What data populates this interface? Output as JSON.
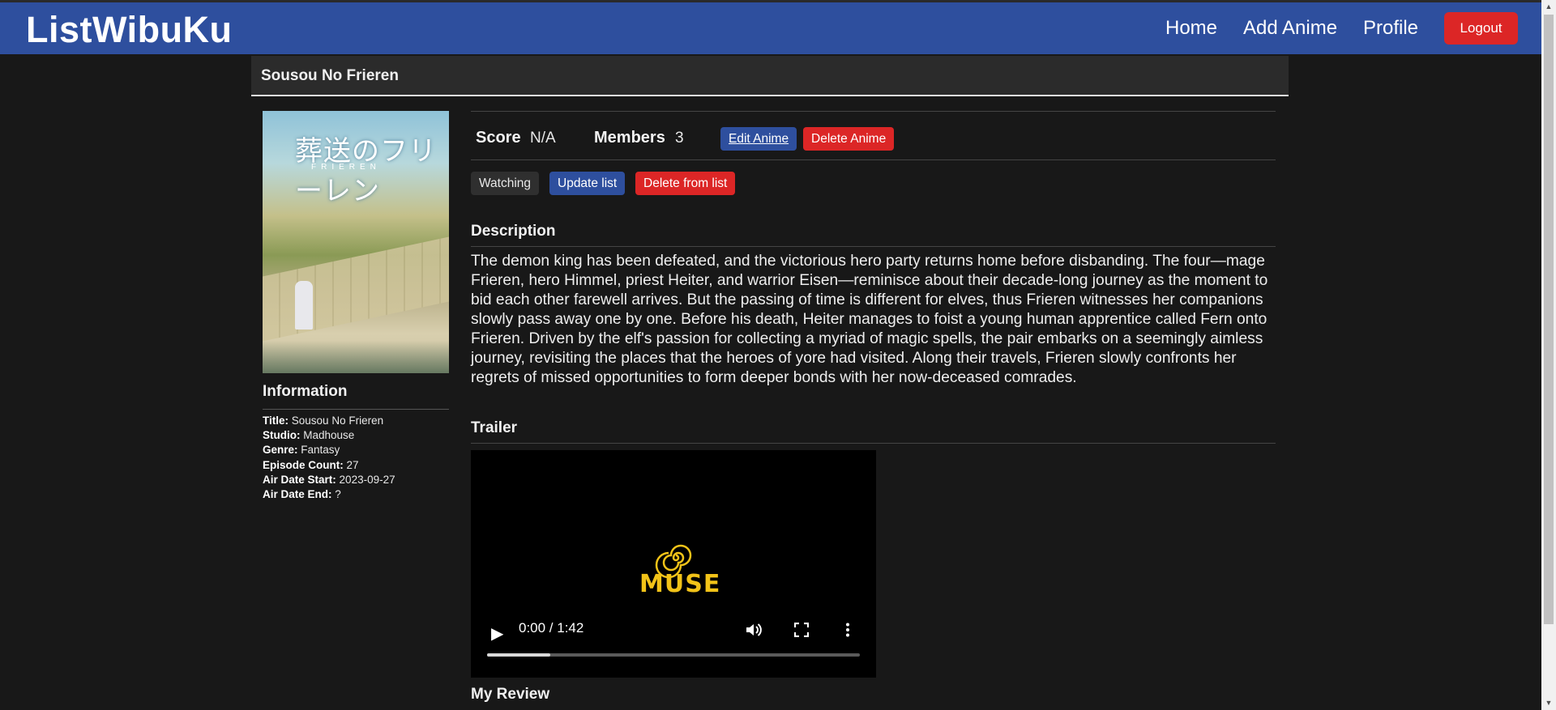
{
  "navbar": {
    "brand": "ListWibuKu",
    "links": [
      "Home",
      "Add Anime",
      "Profile"
    ],
    "logout_label": "Logout",
    "color": "#2e4f9e"
  },
  "anime": {
    "title": "Sousou No Frieren",
    "poster_title": "葬送のフリーレン",
    "poster_subtitle": "FRIEREN",
    "score_label": "Score",
    "score_value": "N/A",
    "members_label": "Members",
    "members_value": "3",
    "edit_label": "Edit Anime",
    "delete_label": "Delete Anime",
    "list_status": "Watching",
    "update_list_label": "Update list",
    "delete_from_list_label": "Delete from list"
  },
  "information": {
    "heading": "Information",
    "rows": [
      {
        "label": "Title:",
        "value": "Sousou No Frieren"
      },
      {
        "label": "Studio:",
        "value": "Madhouse"
      },
      {
        "label": "Genre:",
        "value": "Fantasy"
      },
      {
        "label": "Episode Count:",
        "value": "27"
      },
      {
        "label": "Air Date Start:",
        "value": "2023-09-27"
      },
      {
        "label": "Air Date End:",
        "value": "?"
      }
    ]
  },
  "description": {
    "heading": "Description",
    "text": "The demon king has been defeated, and the victorious hero party returns home before disbanding. The four—mage Frieren, hero Himmel, priest Heiter, and warrior Eisen—reminisce about their decade-long journey as the moment to bid each other farewell arrives. But the passing of time is different for elves, thus Frieren witnesses her companions slowly pass away one by one. Before his death, Heiter manages to foist a young human apprentice called Fern onto Frieren. Driven by the elf's passion for collecting a myriad of magic spells, the pair embarks on a seemingly aimless journey, revisiting the places that the heroes of yore had visited. Along their travels, Frieren slowly confronts her regrets of missed opportunities to form deeper bonds with her now-deceased comrades."
  },
  "trailer": {
    "heading": "Trailer",
    "logo_text": "MUSE",
    "time": "0:00 / 1:42",
    "buffered_fraction": 0.17
  },
  "review": {
    "heading": "My Review"
  }
}
